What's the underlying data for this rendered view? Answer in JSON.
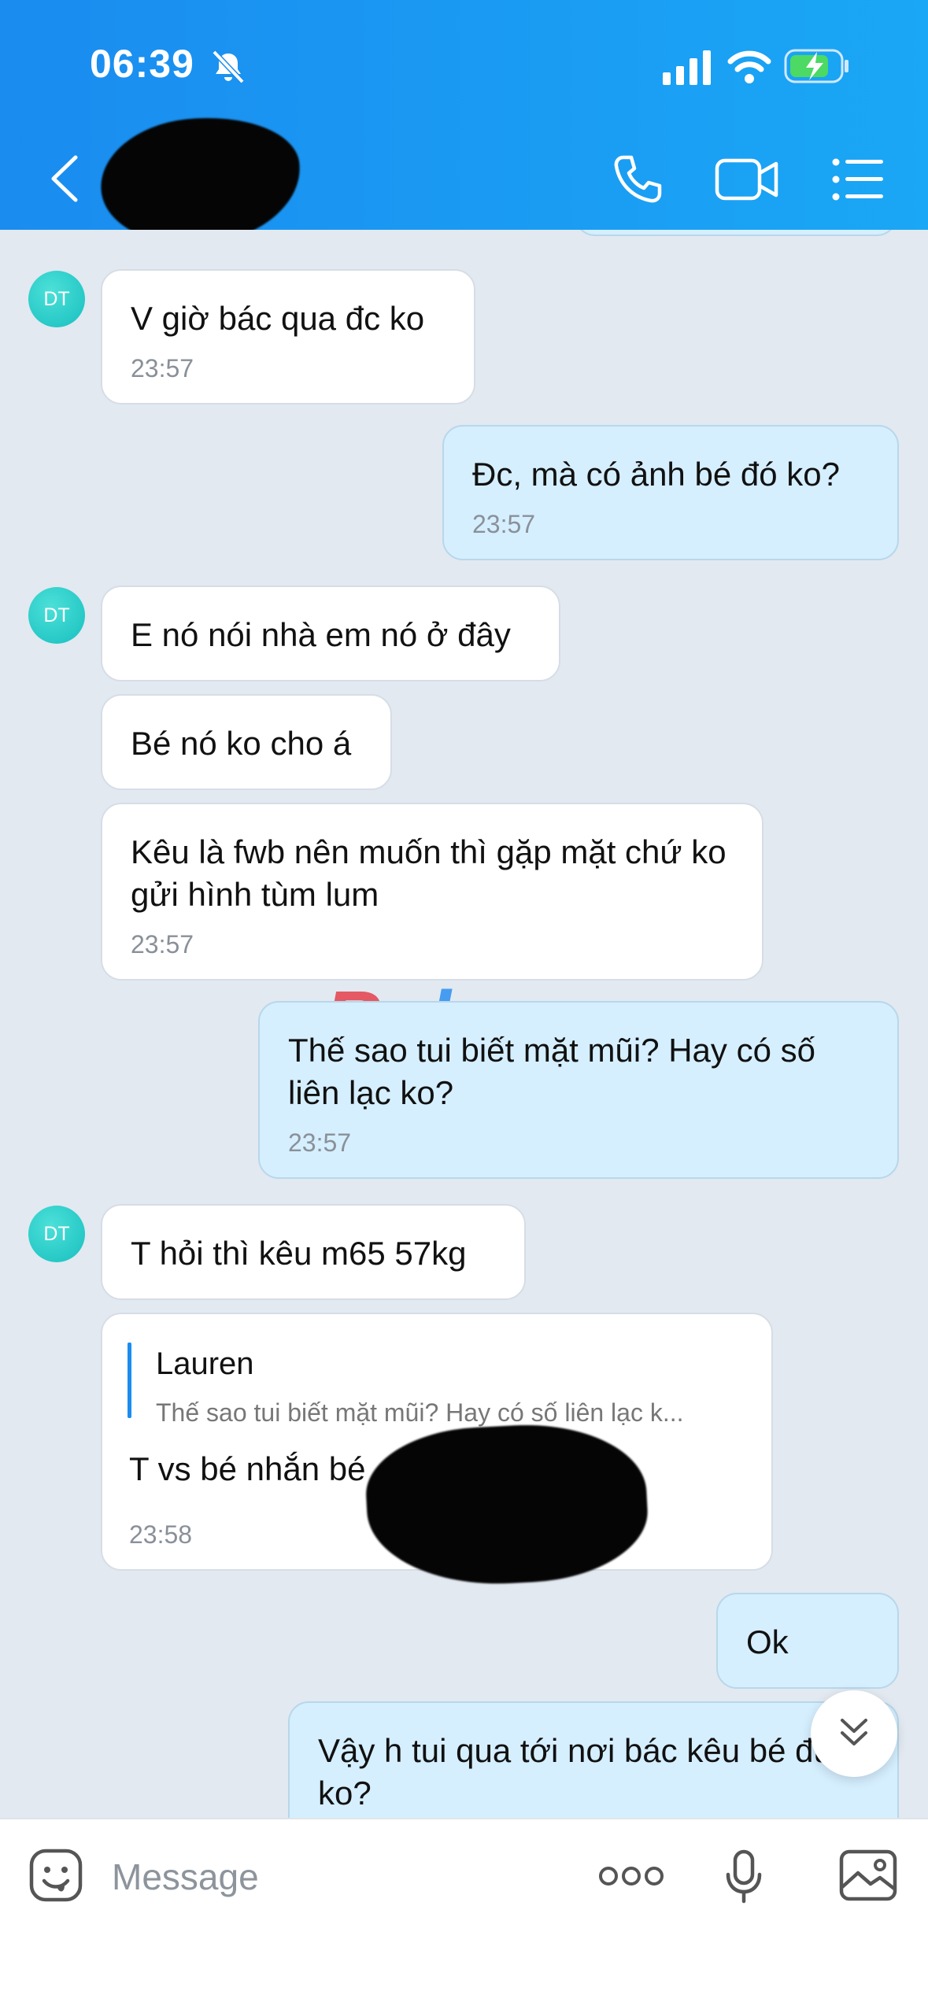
{
  "status_bar": {
    "time": "06:39"
  },
  "header": {
    "contact_name_redacted": true
  },
  "avatar_initials": "DT",
  "messages": [
    {
      "side": "in",
      "text": "V giờ bác qua đc ko",
      "time": "23:57"
    },
    {
      "side": "out",
      "text": "Đc, mà có ảnh bé đó ko?",
      "time": "23:57"
    },
    {
      "side": "in",
      "text": "E nó nói nhà em nó ở đây",
      "time": ""
    },
    {
      "side": "in",
      "text": "Bé nó ko cho á",
      "time": ""
    },
    {
      "side": "in",
      "text": "Kêu là fwb nên muốn thì gặp mặt chứ ko gửi hình tùm lum",
      "time": "23:57"
    },
    {
      "side": "out",
      "text": "Thế sao tui biết mặt mũi? Hay có số liên lạc ko?",
      "time": "23:57"
    },
    {
      "side": "in",
      "text": "T hỏi thì kêu m65 57kg",
      "time": ""
    },
    {
      "side": "in",
      "quote_name": "Lauren",
      "quote_text": "Thế sao tui biết mặt mũi? Hay có số liên lạc k...",
      "text": "T vs bé nhắn bé",
      "time": "23:58"
    },
    {
      "side": "out",
      "text": "Ok",
      "time": ""
    },
    {
      "side": "out",
      "text": "Vậy h tui qua tới nơi bác kêu bé đúng ko?",
      "time": ""
    }
  ],
  "watermark": {
    "part1": "R",
    "part2": "phang"
  },
  "input": {
    "placeholder": "Message"
  },
  "colors": {
    "header": "#1a8cf0",
    "incoming": "#ffffff",
    "outgoing": "#d5efff",
    "background": "#e2e9f1"
  }
}
